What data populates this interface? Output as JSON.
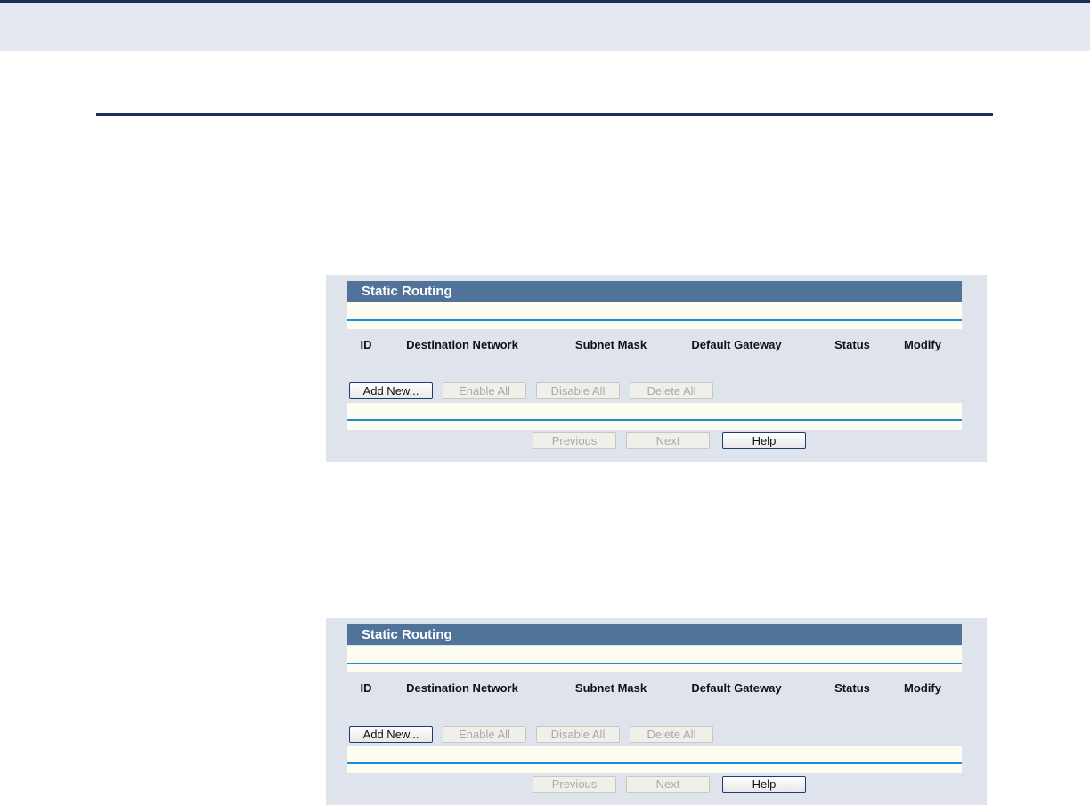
{
  "panels": [
    {
      "title": "Static Routing",
      "columns": [
        "ID",
        "Destination Network",
        "Subnet Mask",
        "Default Gateway",
        "Status",
        "Modify"
      ],
      "action_buttons": [
        "Add New...",
        "Enable All",
        "Disable All",
        "Delete All"
      ],
      "nav_buttons": [
        "Previous",
        "Next",
        "Help"
      ]
    },
    {
      "title": "Static Routing",
      "columns": [
        "ID",
        "Destination Network",
        "Subnet Mask",
        "Default Gateway",
        "Status",
        "Modify"
      ],
      "action_buttons": [
        "Add New...",
        "Enable All",
        "Disable All",
        "Delete All"
      ],
      "nav_buttons": [
        "Previous",
        "Next",
        "Help"
      ]
    }
  ],
  "colors": {
    "title_bar": "#50739a",
    "panel_bg": "#dfe4ec",
    "row_bg": "#fdfdf2",
    "separator": "#1a8fd6",
    "header_rule": "#1b3060"
  }
}
